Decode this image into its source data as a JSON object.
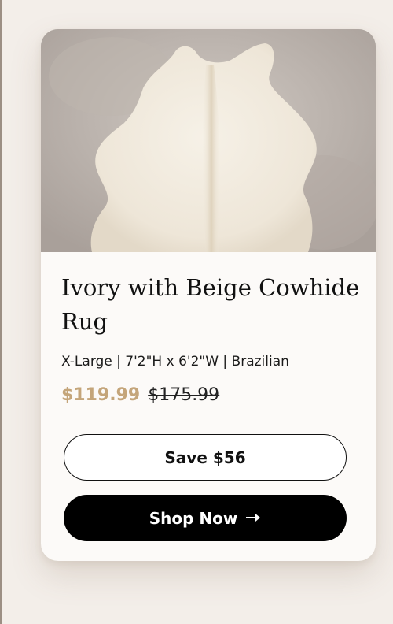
{
  "product": {
    "title": "Ivory with Beige Cowhide Rug",
    "specs": "X-Large | 7'2\"H x 6'2\"W | Brazilian",
    "price_current": "$119.99",
    "price_original": "$175.99",
    "save_label": "Save $56",
    "shop_label": "Shop Now",
    "shop_icon": "arrow-right-icon",
    "image": "cowhide-rug-photo"
  },
  "colors": {
    "page_background": "#f3eee9",
    "card_background": "#fcfaf8",
    "price_accent": "#c4a57a",
    "primary_button": "#000000"
  }
}
